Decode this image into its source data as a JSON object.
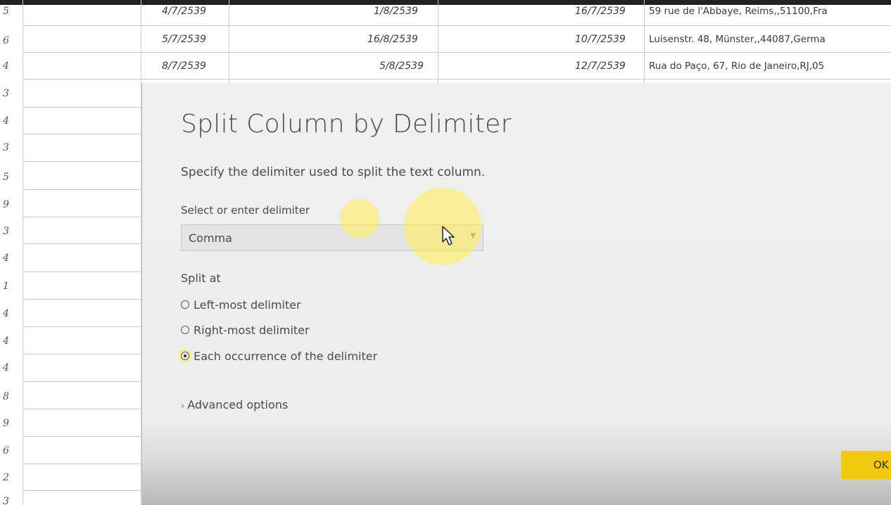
{
  "sheet": {
    "row_numbers": [
      "5",
      "6",
      "4",
      "3",
      "4",
      "3",
      "5",
      "9",
      "3",
      "4",
      "1",
      "4",
      "4",
      "4",
      "8",
      "9",
      "6",
      "2",
      "3"
    ],
    "rows": [
      {
        "col1": "4/7/2539",
        "col2": "1/8/2539",
        "col3": "16/7/2539",
        "address": "59 rue de l'Abbaye, Reims,,51100,Fra"
      },
      {
        "col1": "5/7/2539",
        "col2": "16/8/2539",
        "col3": "10/7/2539",
        "address": "Luisenstr. 48, Münster,,44087,Germa"
      },
      {
        "col1": "8/7/2539",
        "col2": "5/8/2539",
        "col3": "12/7/2539",
        "address": "Rua do Paço, 67, Rio de Janeiro,RJ,05"
      }
    ]
  },
  "dialog": {
    "title": "Split Column by Delimiter",
    "description": "Specify the delimiter used to split the text column.",
    "delimiter_label": "Select or enter delimiter",
    "delimiter_value": "Comma",
    "split_at_label": "Split at",
    "options": [
      {
        "label": "Left-most delimiter",
        "checked": false
      },
      {
        "label": "Right-most delimiter",
        "checked": false
      },
      {
        "label": "Each occurrence of the delimiter",
        "checked": true
      }
    ],
    "advanced_label": "Advanced options",
    "ok_label": "OK"
  },
  "icons": {
    "combo_arrow": "chevron-down-icon",
    "advanced_chevron": "chevron-right-icon",
    "cursor": "mouse-pointer-icon"
  },
  "colors": {
    "ok_button": "#f2c811",
    "highlight": "#ffee50",
    "dialog_bg": "#f0f0f0"
  }
}
